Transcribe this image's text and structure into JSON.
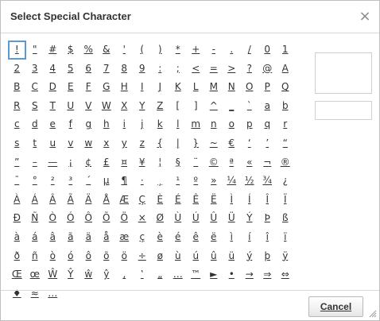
{
  "dialog": {
    "title": "Select Special Character",
    "close_glyph": "×",
    "cancel_label": "Cancel",
    "selected_index": 0
  },
  "characters": [
    "!",
    "\"",
    "#",
    "$",
    "%",
    "&",
    "'",
    "(",
    ")",
    "*",
    "+",
    "-",
    ".",
    "/",
    "0",
    "1",
    "2",
    "3",
    "4",
    "5",
    "6",
    "7",
    "8",
    "9",
    ":",
    ";",
    "<",
    "=",
    ">",
    "?",
    "@",
    "A",
    "B",
    "C",
    "D",
    "E",
    "F",
    "G",
    "H",
    "I",
    "J",
    "K",
    "L",
    "M",
    "N",
    "O",
    "P",
    "Q",
    "R",
    "S",
    "T",
    "U",
    "V",
    "W",
    "X",
    "Y",
    "Z",
    "[",
    "]",
    "^",
    "_",
    "`",
    "a",
    "b",
    "c",
    "d",
    "e",
    "f",
    "g",
    "h",
    "i",
    "j",
    "k",
    "l",
    "m",
    "n",
    "o",
    "p",
    "q",
    "r",
    "s",
    "t",
    "u",
    "v",
    "w",
    "x",
    "y",
    "z",
    "{",
    "|",
    "}",
    "~",
    "€",
    "‘",
    "’",
    "“",
    "”",
    "–",
    "—",
    "¡",
    "¢",
    "£",
    "¤",
    "¥",
    "¦",
    "§",
    "¨",
    "©",
    "ª",
    "«",
    "¬",
    "®",
    "¯",
    "°",
    "²",
    "³",
    "´",
    "µ",
    "¶",
    "·",
    "¸",
    "¹",
    "º",
    "»",
    "¼",
    "½",
    "¾",
    "¿",
    "À",
    "Á",
    "Â",
    "Ã",
    "Ä",
    "Å",
    "Æ",
    "Ç",
    "È",
    "É",
    "Ê",
    "Ë",
    "Ì",
    "Í",
    "Î",
    "Ï",
    "Ð",
    "Ñ",
    "Ò",
    "Ó",
    "Ô",
    "Õ",
    "Ö",
    "×",
    "Ø",
    "Ù",
    "Ú",
    "Û",
    "Ü",
    "Ý",
    "Þ",
    "ß",
    "à",
    "á",
    "â",
    "ã",
    "ä",
    "å",
    "æ",
    "ç",
    "è",
    "é",
    "ê",
    "ë",
    "ì",
    "í",
    "î",
    "ï",
    "ð",
    "ñ",
    "ò",
    "ó",
    "ô",
    "õ",
    "ö",
    "÷",
    "ø",
    "ù",
    "ú",
    "û",
    "ü",
    "ý",
    "þ",
    "ÿ",
    "Œ",
    "œ",
    "Ŵ",
    "Ŷ",
    "ŵ",
    "ŷ",
    "‚",
    "‛",
    "„",
    "…",
    "™",
    "►",
    "•",
    "→",
    "⇒",
    "⇔",
    "♦",
    "≈",
    "…"
  ],
  "colors": {
    "selection_outline": "#5a9bd5",
    "border": "#bfbfbf",
    "text": "#333333"
  },
  "icons": {
    "close": "close-icon",
    "resize": "resize-grip-icon"
  }
}
